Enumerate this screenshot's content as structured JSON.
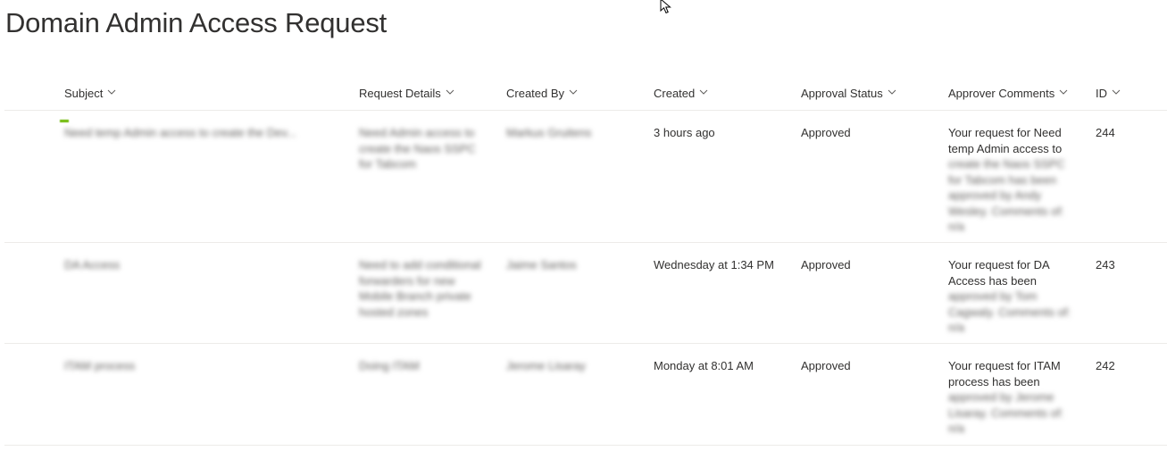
{
  "page": {
    "title": "Domain Admin Access Request"
  },
  "columns": [
    {
      "key": "subject",
      "label": "Subject"
    },
    {
      "key": "request_details",
      "label": "Request Details"
    },
    {
      "key": "created_by",
      "label": "Created By"
    },
    {
      "key": "created",
      "label": "Created"
    },
    {
      "key": "approval_status",
      "label": "Approval Status"
    },
    {
      "key": "approver_comments",
      "label": "Approver Comments"
    },
    {
      "key": "id",
      "label": "ID"
    }
  ],
  "rows": [
    {
      "subject": "Need temp Admin access to create the Dev...",
      "request_details": "Need Admin access to create the Naos SSPC for Tabcom",
      "created_by": "Markus Gruitens",
      "created": "3 hours ago",
      "approval_status": "Approved",
      "approver_comments_visible": "Your request for Need temp Admin access to",
      "approver_comments_hidden": "create the Naos SSPC for Tabcom has been approved by Andy Wesley. Comments of: n/a"
    },
    {
      "subject": "DA Access",
      "request_details": "Need to add conditional forwarders for new Mobile Branch private hosted zones",
      "created_by": "Jaime Santos",
      "created": "Wednesday at 1:34 PM",
      "approval_status": "Approved",
      "approver_comments_visible": "Your request for DA Access has been",
      "approver_comments_hidden": "approved by Tom Cagwaly. Comments of: n/a"
    },
    {
      "subject": "ITAM process",
      "request_details": "Doing ITAM",
      "created_by": "Jerome Lisaray",
      "created": "Monday at 8:01 AM",
      "approval_status": "Approved",
      "approver_comments_visible": "Your request for ITAM process has been",
      "approver_comments_hidden": "approved by Jerome Lisaray. Comments of: n/a"
    }
  ],
  "ids": [
    "244",
    "243",
    "242"
  ]
}
